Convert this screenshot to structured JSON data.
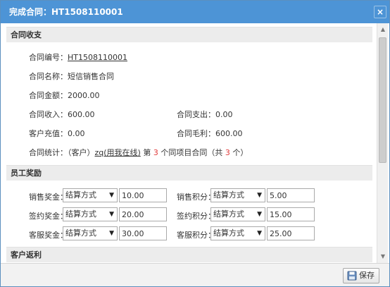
{
  "dialog": {
    "title": "完成合同：HT1508110001",
    "close_glyph": "×"
  },
  "sections": {
    "contract": {
      "header": "合同收支",
      "number_label": "合同编号：",
      "number_value": "HT1508110001",
      "name_label": "合同名称：",
      "name_value": "短信销售合同",
      "amount_label": "合同金额：",
      "amount_value": "2000.00",
      "income_label": "合同收入：",
      "income_value": "600.00",
      "expense_label": "合同支出：",
      "expense_value": "0.00",
      "recharge_label": "客户充值：",
      "recharge_value": "0.00",
      "profit_label": "合同毛利：",
      "profit_value": "600.00",
      "stats_label": "合同统计：",
      "stats_prefix": "（客户）",
      "stats_customer": "zq(用我在线)",
      "stats_mid1": " 第 ",
      "stats_nth": "3",
      "stats_mid2": " 个同项目合同（共 ",
      "stats_total": "3",
      "stats_suffix": " 个）"
    },
    "reward": {
      "header": "员工奖励",
      "rows": [
        {
          "left_label": "销售奖金：",
          "left_method": "结算方式",
          "left_value": "10.00",
          "right_label": "销售积分：",
          "right_method": "结算方式",
          "right_value": "5.00"
        },
        {
          "left_label": "签约奖金：",
          "left_method": "结算方式",
          "left_value": "20.00",
          "right_label": "签约积分：",
          "right_method": "结算方式",
          "right_value": "15.00"
        },
        {
          "left_label": "客服奖金：",
          "left_method": "结算方式",
          "left_value": "30.00",
          "right_label": "客服积分：",
          "right_method": "结算方式",
          "right_value": "25.00"
        }
      ]
    },
    "rebate": {
      "header": "客户返利"
    }
  },
  "footer": {
    "save_label": "保存"
  },
  "colors": {
    "titlebar": "#4d94d6",
    "highlight": "#e03b3b"
  },
  "icons": {
    "close": "close-icon",
    "save": "save-icon",
    "scroll_up": "scroll-up-icon",
    "scroll_down": "scroll-down-icon",
    "dropdown": "chevron-down-icon"
  }
}
